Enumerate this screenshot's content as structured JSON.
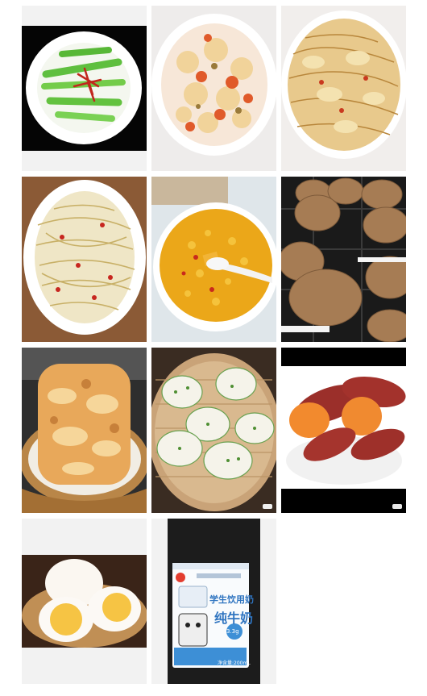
{
  "gallery": {
    "photos": [
      {
        "subject": "stir-fried celery with chili"
      },
      {
        "subject": "tomato cauliflower stir-fry"
      },
      {
        "subject": "cabbage with glass noodles"
      },
      {
        "subject": "stir-fried bean sprouts"
      },
      {
        "subject": "pumpkin millet porridge"
      },
      {
        "subject": "brown sugar steamed buns"
      },
      {
        "subject": "pan-fried flatbread in basket"
      },
      {
        "subject": "scallion flower rolls in steamer"
      },
      {
        "subject": "roasted sweet potatoes"
      },
      {
        "subject": "boiled eggs"
      },
      {
        "subject": "student milk carton"
      }
    ]
  },
  "milk_carton": {
    "line1": "学生饮用奶",
    "line2": "纯牛奶",
    "badge": "3.3g",
    "volume": "净含量:200mL"
  },
  "colors": {
    "background": "#ffffff",
    "tile_frame": "#f2f2f2",
    "carton_blue": "#3d8fd6"
  }
}
